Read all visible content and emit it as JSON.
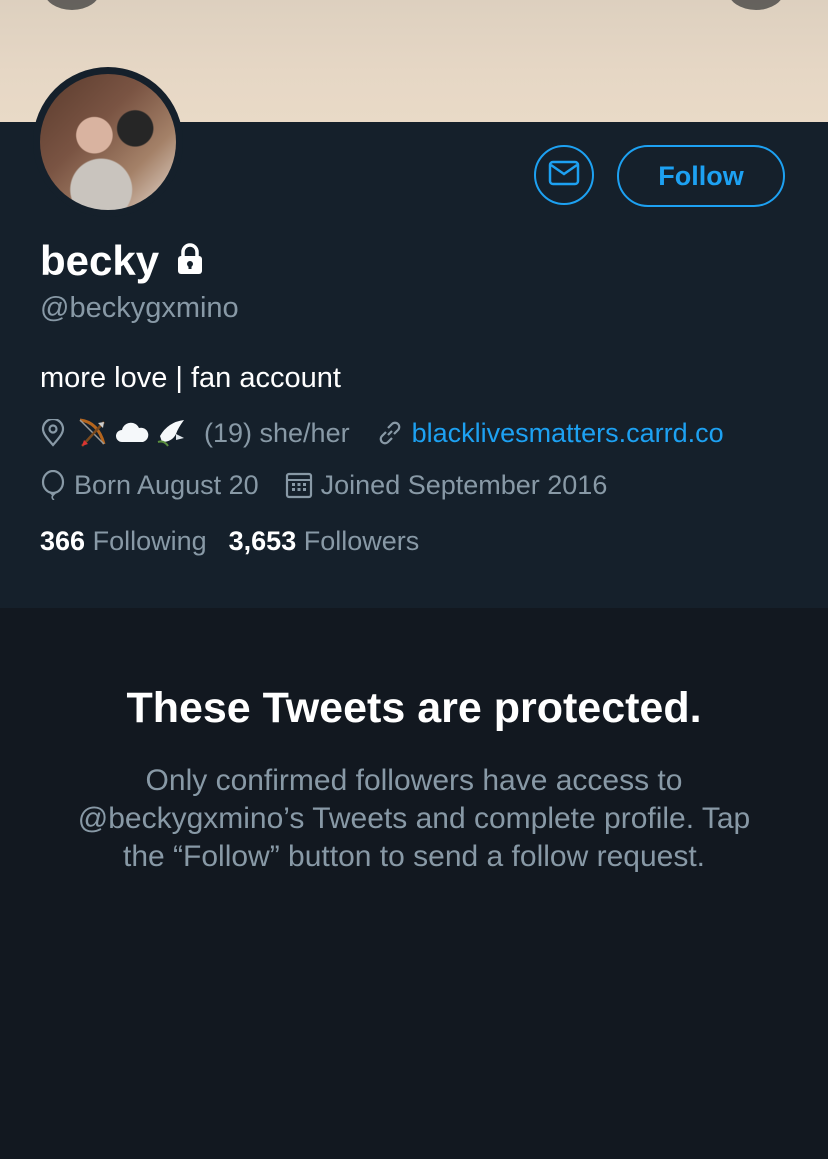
{
  "profile": {
    "name": "becky",
    "handle": "@beckygxmino",
    "bio": "more love | fan account",
    "location_text": "(19) she/her",
    "website": "blacklivesmatters.carrd.co",
    "birthday": "Born August 20",
    "joined": "Joined September 2016",
    "following_count": "366",
    "following_label": "Following",
    "followers_count": "3,653",
    "followers_label": "Followers"
  },
  "actions": {
    "follow_label": "Follow"
  },
  "protected": {
    "title": "These Tweets are protected.",
    "message": "Only confirmed followers have access to @beckygxmino’s Tweets and complete profile. Tap the “Follow” button to send a follow request."
  },
  "colors": {
    "accent": "#1da1f2",
    "profile_bg": "#15202b",
    "page_bg": "#121820",
    "secondary_text": "#8899a6"
  },
  "icons": [
    "envelope-icon",
    "lock-icon",
    "location-pin-icon",
    "bow-and-arrow-emoji",
    "cloud-emoji",
    "dove-emoji",
    "link-icon",
    "balloon-icon",
    "calendar-icon"
  ]
}
